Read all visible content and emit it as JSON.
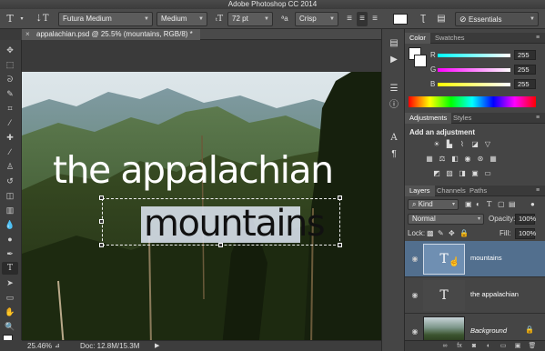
{
  "app": {
    "title": "Adobe Photoshop CC 2014"
  },
  "options_bar": {
    "tool_icon": "type-tool-icon",
    "font_family": "Futura Medium",
    "font_style": "Medium",
    "font_size": "72 pt",
    "aa_label": "ªa",
    "anti_alias": "Crisp",
    "workspace": "Essentials"
  },
  "document": {
    "tab_title": "appalachian.psd @ 25.5% (mountains, RGB/8) *",
    "text_line1": "the appalachian",
    "text_line2": "mountains"
  },
  "status_bar": {
    "zoom": "25.46%",
    "doc_size": "Doc: 12.8M/15.3M"
  },
  "color_panel": {
    "tabs": [
      "Color",
      "Swatches"
    ],
    "channels": [
      {
        "label": "R",
        "value": "255"
      },
      {
        "label": "G",
        "value": "255"
      },
      {
        "label": "B",
        "value": "255"
      }
    ]
  },
  "adjustments_panel": {
    "tabs": [
      "Adjustments",
      "Styles"
    ],
    "heading": "Add an adjustment"
  },
  "layers_panel": {
    "tabs": [
      "Layers",
      "Channels",
      "Paths"
    ],
    "filter_kind": "Kind",
    "blend_mode": "Normal",
    "opacity_label": "Opacity:",
    "opacity": "100%",
    "lock_label": "Lock:",
    "fill_label": "Fill:",
    "fill": "100%",
    "layers": [
      {
        "name": "mountains",
        "type": "text",
        "selected": true,
        "thumb_glyph": "T"
      },
      {
        "name": "the appalachian",
        "type": "text",
        "selected": false,
        "thumb_glyph": "T"
      },
      {
        "name": "Background",
        "type": "image",
        "selected": false,
        "locked": true
      }
    ]
  },
  "colors": {
    "accent": "#4a6c8c",
    "selected_layer": "#526f8e",
    "panel_bg": "#454545"
  }
}
